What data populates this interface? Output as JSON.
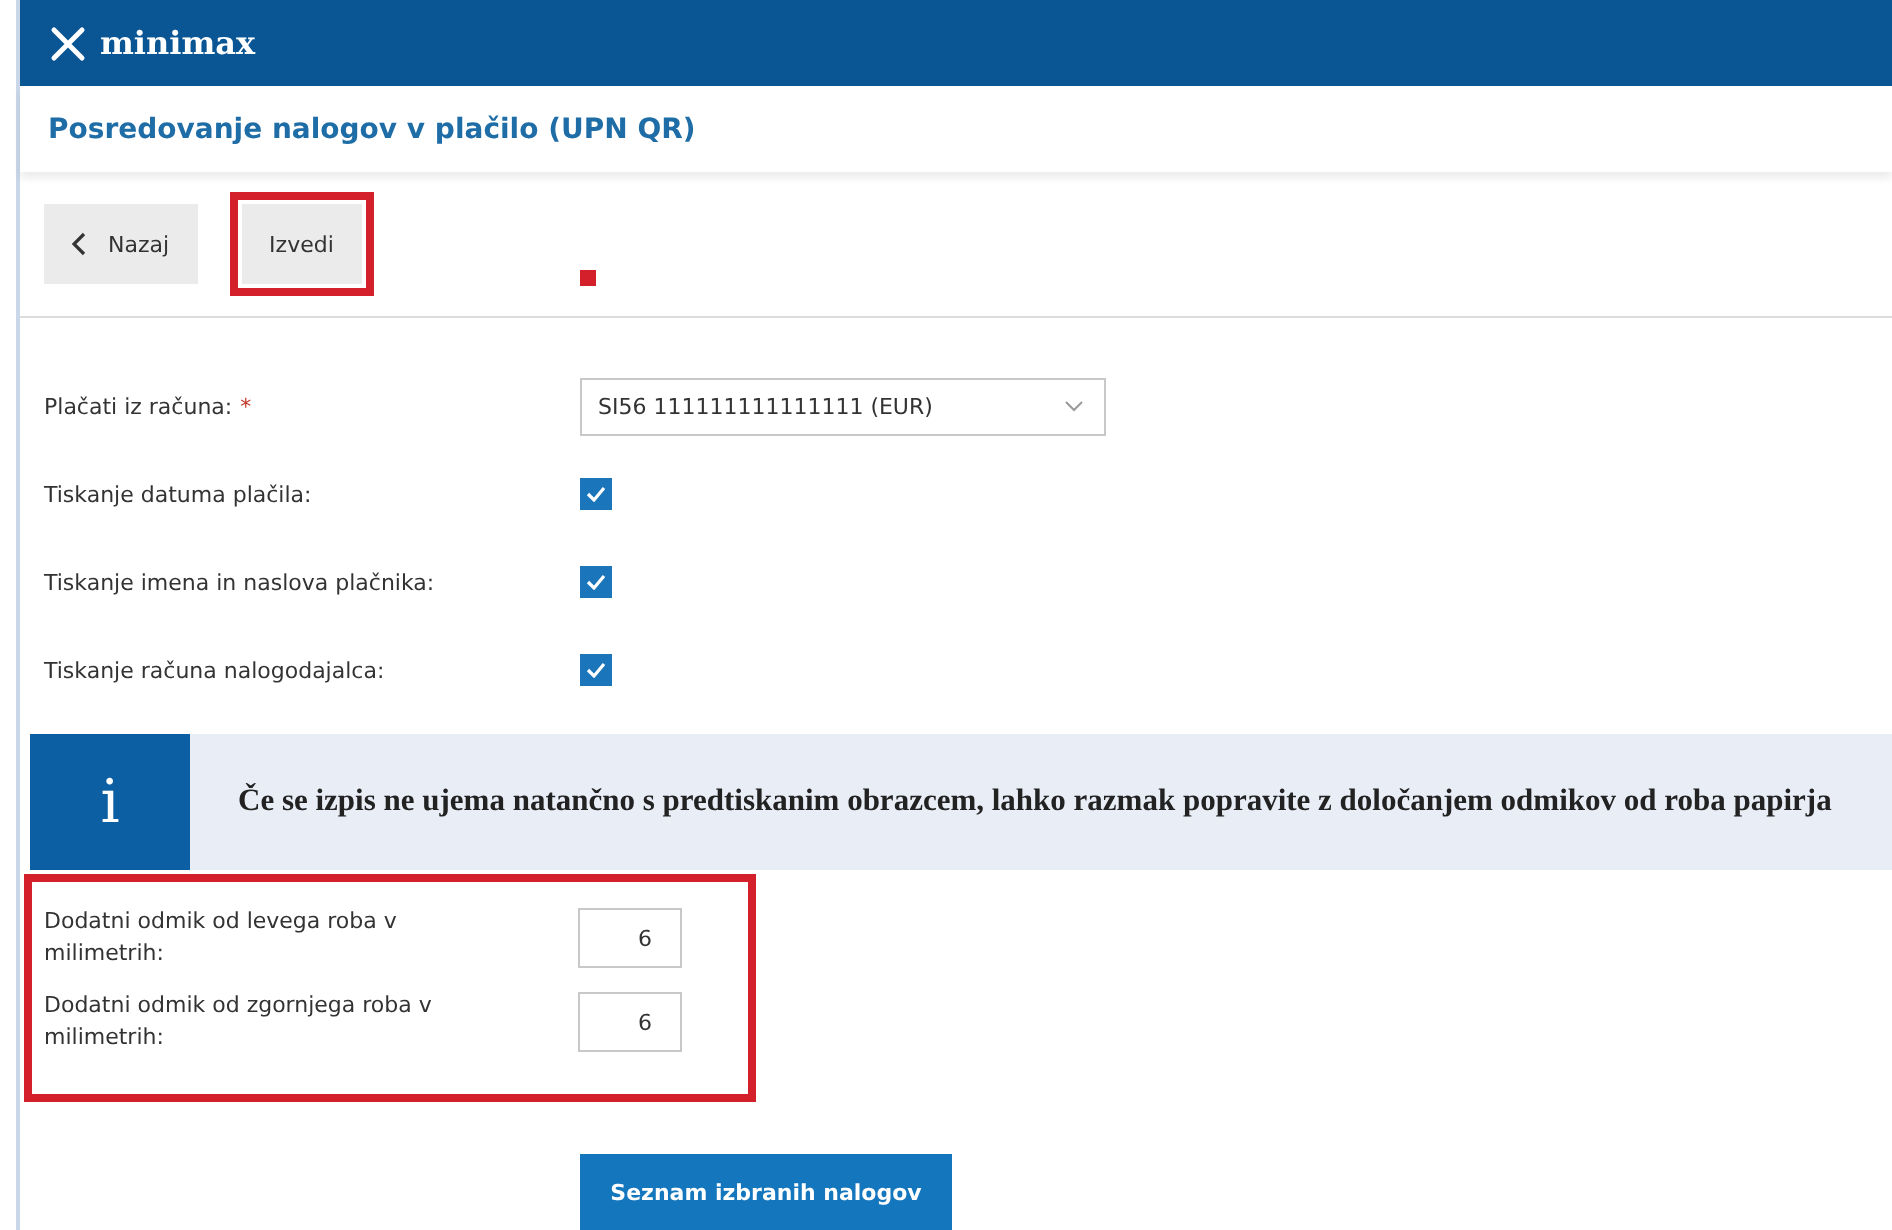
{
  "app": {
    "logo": "minimax"
  },
  "page_title": "Posredovanje nalogov v plačilo (UPN QR)",
  "toolbar": {
    "buttons": [
      {
        "label": "Nazaj",
        "kind": "back",
        "highlighted": false
      },
      {
        "label": "Izvedi",
        "kind": "plain",
        "highlighted": true
      }
    ],
    "annotation_dot": true
  },
  "form": {
    "account": {
      "label": "Plačati iz računa:",
      "required_mark": "*",
      "value": "SI56 111111111111111 (EUR)"
    },
    "checkboxes": [
      {
        "label": "Tiskanje datuma plačila:",
        "checked": true
      },
      {
        "label": "Tiskanje imena in naslova plačnika:",
        "checked": true
      },
      {
        "label": "Tiskanje računa nalogodajalca:",
        "checked": true
      }
    ]
  },
  "info": {
    "icon": "i",
    "text": "Če se izpis ne ujema natančno s predtiskanim obrazcem, lahko razmak popravite z določanjem odmikov od roba papirja"
  },
  "offsets": {
    "highlighted": true,
    "fields": [
      {
        "label": "Dodatni odmik od levega roba v milimetrih:",
        "value": "6"
      },
      {
        "label": "Dodatni odmik od zgornjega roba v milimetrih:",
        "value": "6"
      }
    ]
  },
  "submit": {
    "label": "Seznam izbranih nalogov"
  }
}
